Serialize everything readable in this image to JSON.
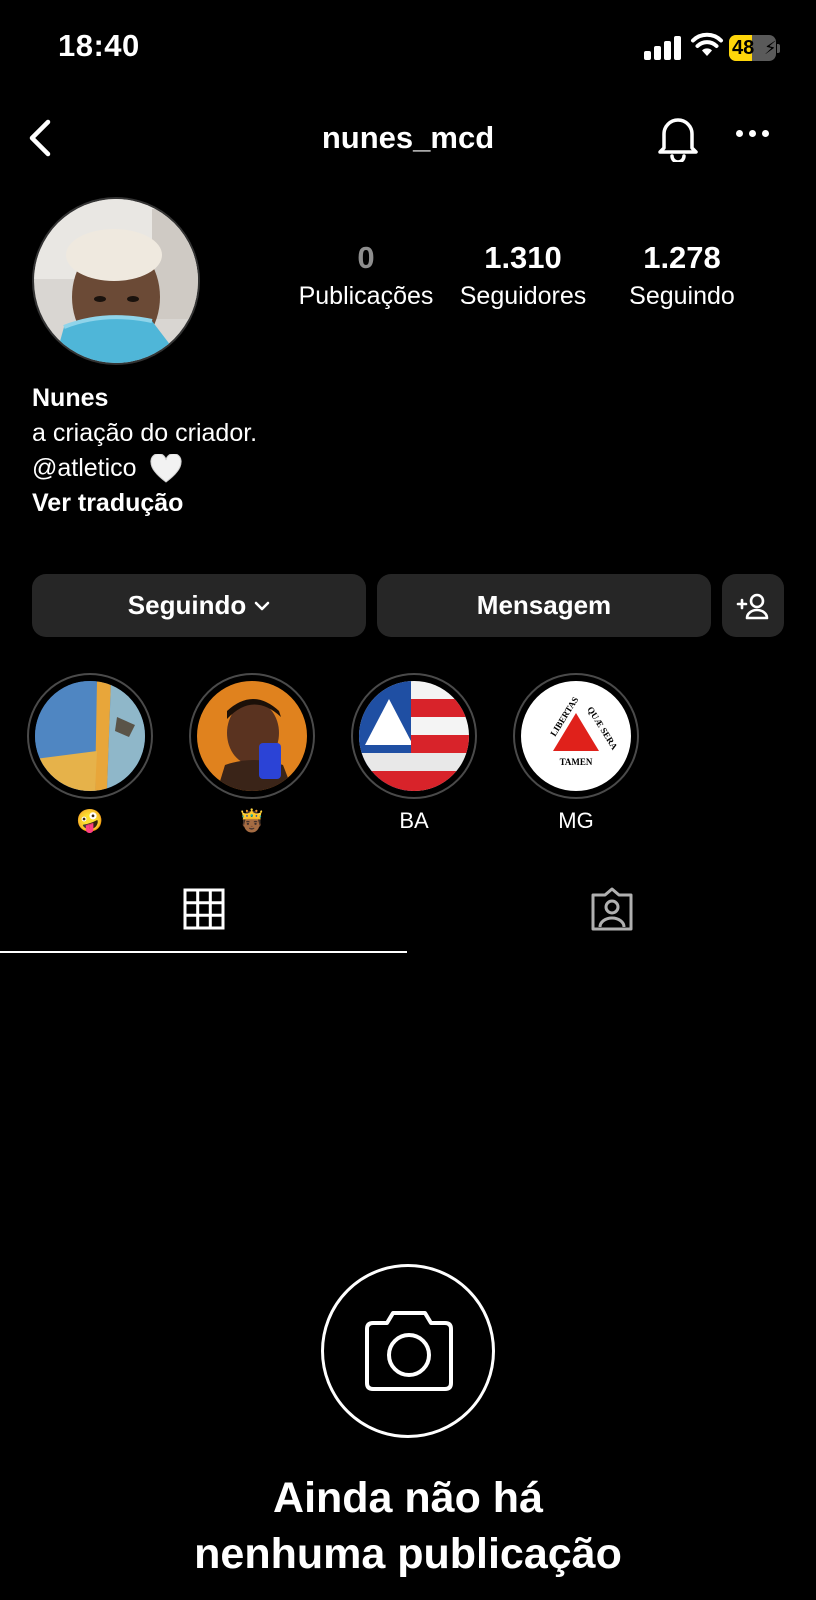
{
  "status_bar": {
    "time": "18:40",
    "battery_level": "48",
    "battery_fraction": 0.48,
    "icons": [
      "cellular-signal-icon",
      "wifi-icon",
      "battery-charging-icon"
    ]
  },
  "header": {
    "username": "nunes_mcd",
    "icons": [
      "chevron-left-icon",
      "bell-icon",
      "more-horizontal-icon"
    ]
  },
  "profile": {
    "stats": [
      {
        "value": "0",
        "label": "Publicações"
      },
      {
        "value": "1.310",
        "label": "Seguidores"
      },
      {
        "value": "1.278",
        "label": "Seguindo"
      }
    ],
    "name": "Nunes",
    "bio_line1": "a criação do criador.",
    "bio_mention": "@atletico",
    "bio_emoji": "white-heart-icon",
    "translate": "Ver tradução"
  },
  "actions": {
    "following": "Seguindo",
    "message": "Mensagem",
    "add_user_icon": "add-user-icon"
  },
  "highlights": [
    {
      "label": "🤪",
      "image": "beach-sunset"
    },
    {
      "label": "🤴🏾",
      "image": "selfie"
    },
    {
      "label": "BA",
      "image": "bahia-flag"
    },
    {
      "label": "MG",
      "image": "minas-gerais-flag"
    }
  ],
  "mg_flag": {
    "left": "LIBERTAS",
    "right": "QUÆ SERA",
    "bottom": "TAMEN"
  },
  "tabs": [
    "grid-icon",
    "tagged-icon"
  ],
  "empty_state": {
    "title_line1": "Ainda não há",
    "title_line2": "nenhuma publicação"
  },
  "colors": {
    "background": "#000000",
    "button_bg": "#262626",
    "muted_text": "#8e8e8e",
    "battery": "#ffd60a"
  }
}
